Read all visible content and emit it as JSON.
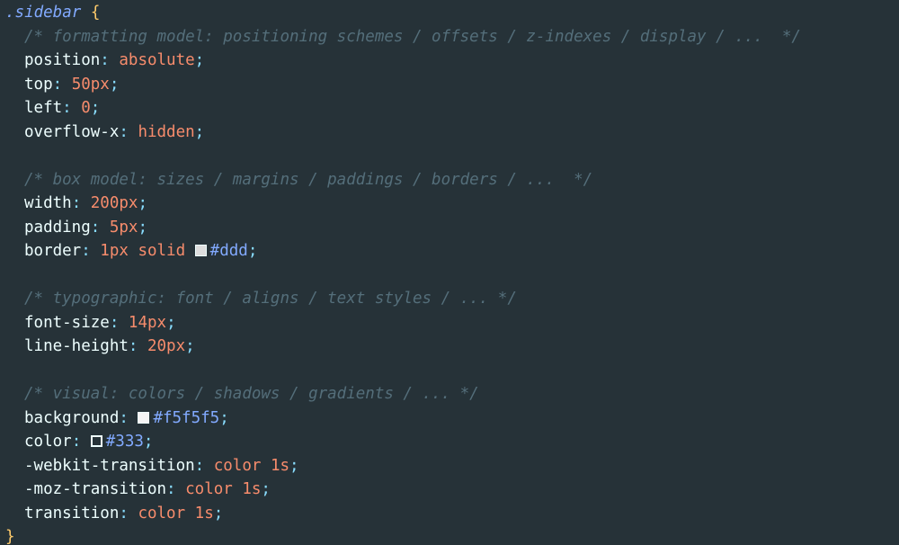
{
  "selector": ".sidebar",
  "open_brace": "{",
  "close_brace": "}",
  "groups": [
    {
      "comment": "/* formatting model: positioning schemes / offsets / z-indexes / display / ...  */",
      "decls": [
        {
          "prop": "position",
          "value": "absolute"
        },
        {
          "prop": "top",
          "value": "50px"
        },
        {
          "prop": "left",
          "value": "0"
        },
        {
          "prop": "overflow-x",
          "value": "hidden"
        }
      ]
    },
    {
      "comment": "/* box model: sizes / margins / paddings / borders / ...  */",
      "decls": [
        {
          "prop": "width",
          "value": "200px"
        },
        {
          "prop": "padding",
          "value": "5px"
        },
        {
          "prop": "border",
          "value": "1px solid",
          "color": "#ddd",
          "swatch_color": "#dddddd",
          "swatch_style": "filled"
        }
      ]
    },
    {
      "comment": "/* typographic: font / aligns / text styles / ... */",
      "decls": [
        {
          "prop": "font-size",
          "value": "14px"
        },
        {
          "prop": "line-height",
          "value": "20px"
        }
      ]
    },
    {
      "comment": "/* visual: colors / shadows / gradients / ... */",
      "decls": [
        {
          "prop": "background",
          "value": "",
          "color": "#f5f5f5",
          "swatch_color": "#f5f5f5",
          "swatch_style": "filled"
        },
        {
          "prop": "color",
          "value": "",
          "color": "#333",
          "swatch_color": "#333333",
          "swatch_style": "outline"
        },
        {
          "prop": "-webkit-transition",
          "value": "color 1s"
        },
        {
          "prop": "-moz-transition",
          "value": "color 1s"
        },
        {
          "prop": "transition",
          "value": "color 1s"
        }
      ]
    }
  ],
  "colors": {
    "background": "#263238",
    "selector": "#82aaff",
    "brace": "#ffcb6b",
    "comment": "#546e7a",
    "property": "#eeffff",
    "punctuation": "#89ddff",
    "value": "#f78c6c",
    "hex": "#82aaff"
  }
}
